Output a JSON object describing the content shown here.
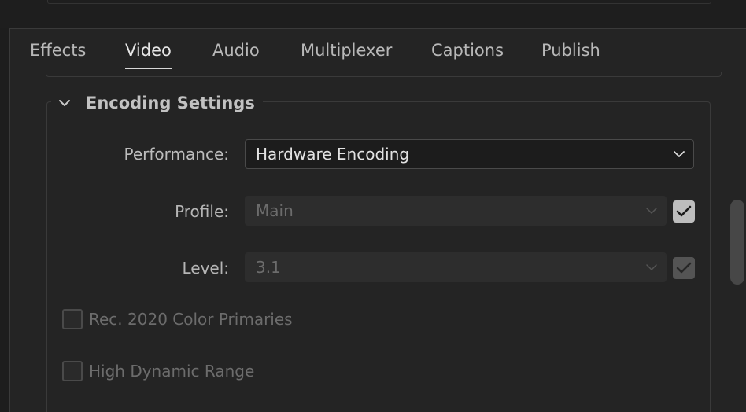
{
  "tabs": [
    {
      "label": "Effects"
    },
    {
      "label": "Video"
    },
    {
      "label": "Audio"
    },
    {
      "label": "Multiplexer"
    },
    {
      "label": "Captions"
    },
    {
      "label": "Publish"
    }
  ],
  "active_tab": "Video",
  "section": {
    "title": "Encoding Settings",
    "chevron_icon": "chevron-down-icon",
    "expanded": true
  },
  "performance": {
    "label": "Performance:",
    "value": "Hardware Encoding",
    "enabled": true
  },
  "profile": {
    "label": "Profile:",
    "value": "Main",
    "enabled": false,
    "checked": true
  },
  "level": {
    "label": "Level:",
    "value": "3.1",
    "enabled": false,
    "checked": true
  },
  "options": [
    {
      "label": "Rec. 2020 Color Primaries",
      "checked": false,
      "enabled": false
    },
    {
      "label": "High Dynamic Range",
      "checked": false,
      "enabled": false
    }
  ],
  "colors": {
    "background": "#242424",
    "text": "#bdbdbd",
    "disabled_text": "#6c6c6c",
    "accent": "#d8d8d8"
  }
}
